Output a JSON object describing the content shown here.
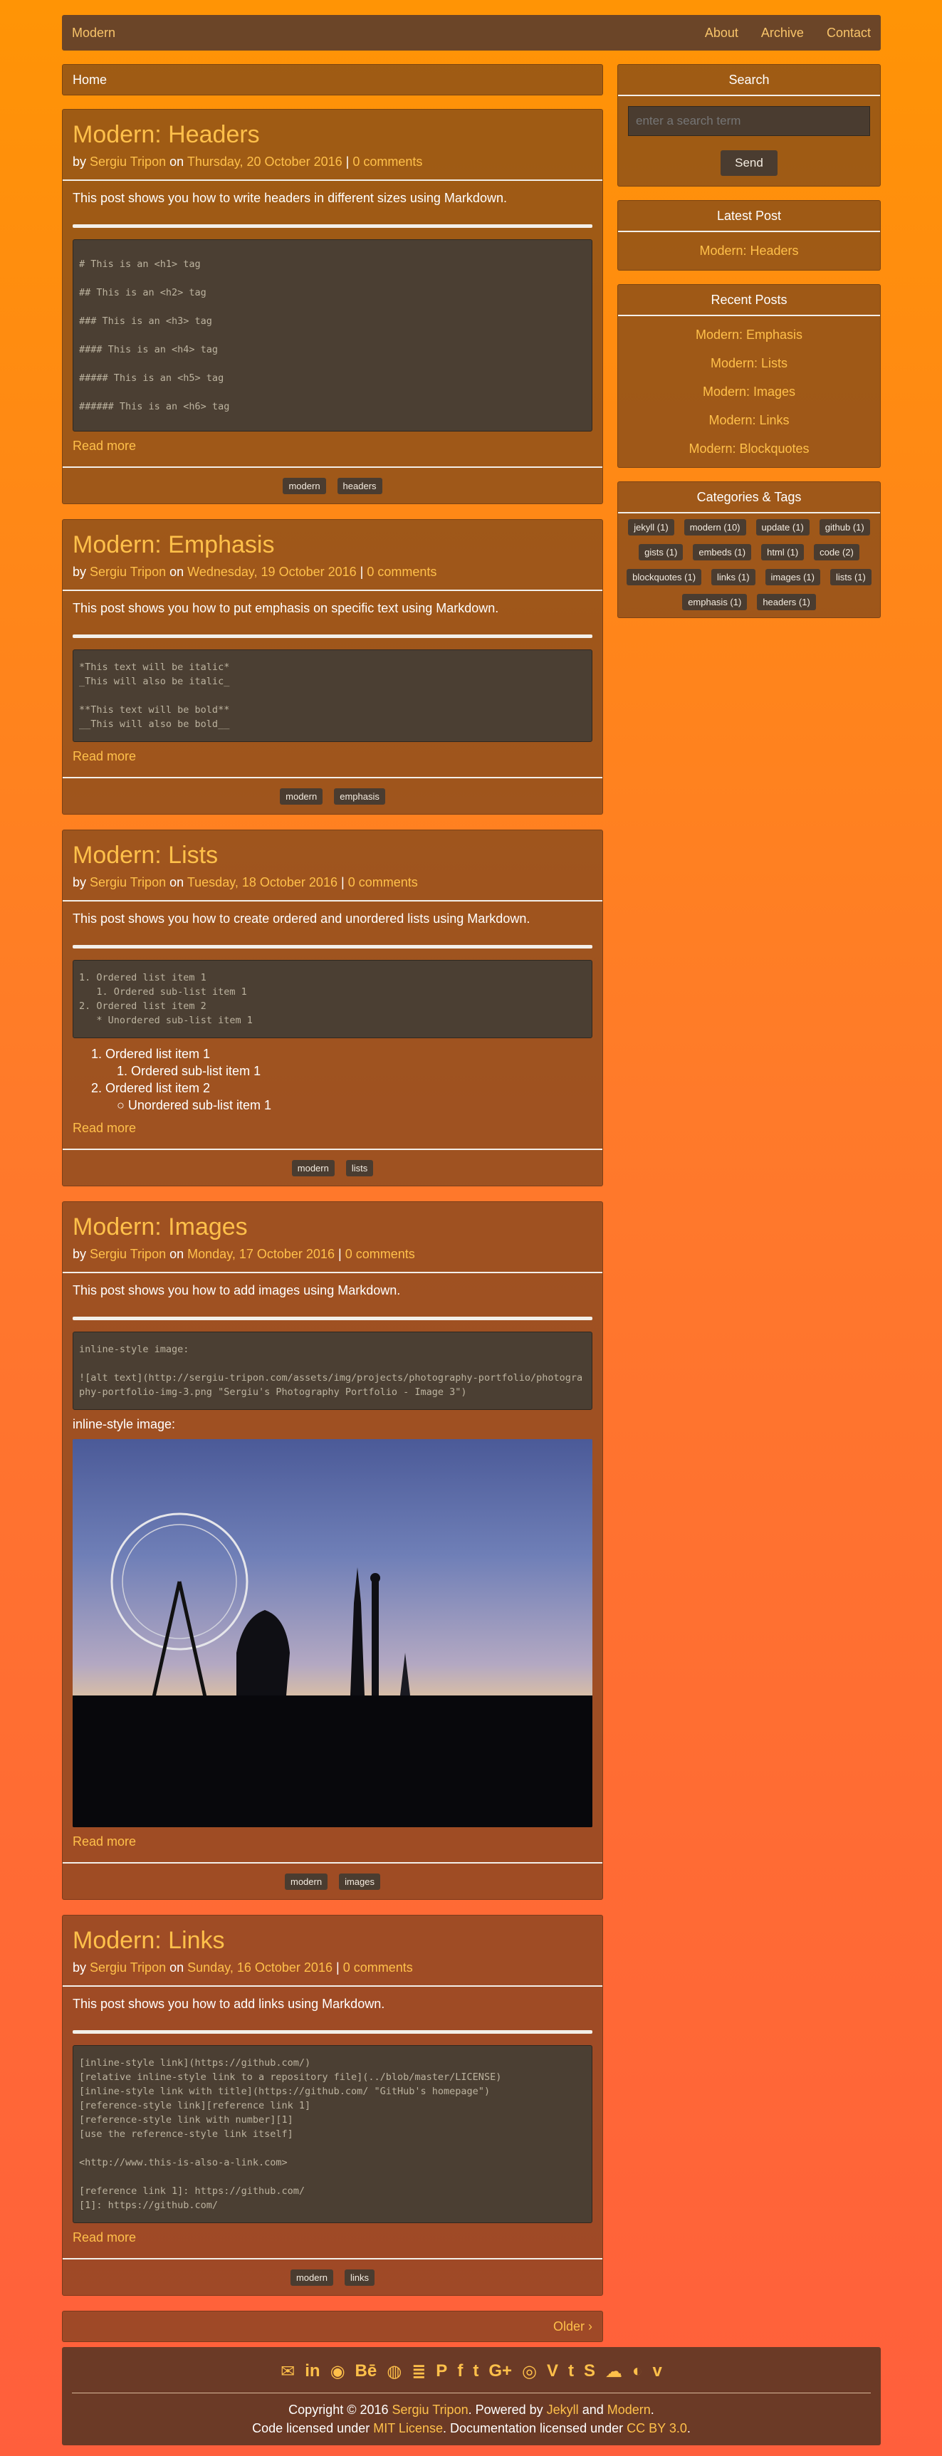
{
  "nav": {
    "brand": "Modern",
    "links": [
      "About",
      "Archive",
      "Contact"
    ]
  },
  "breadcrumb": "Home",
  "posts": [
    {
      "title": "Modern: Headers",
      "by": "by",
      "author": "Sergiu Tripon",
      "on": "on",
      "date": "Thursday, 20 October 2016",
      "sep": "|",
      "comments": "0 comments",
      "excerpt": "This post shows you how to write headers in different sizes using Markdown.",
      "code": "# This is an <h1> tag\n## This is an <h2> tag\n### This is an <h3> tag\n#### This is an <h4> tag\n##### This is an <h5> tag\n###### This is an <h6> tag",
      "read_more": "Read more",
      "tags": [
        "modern",
        "headers"
      ]
    },
    {
      "title": "Modern: Emphasis",
      "by": "by",
      "author": "Sergiu Tripon",
      "on": "on",
      "date": "Wednesday, 19 October 2016",
      "sep": "|",
      "comments": "0 comments",
      "excerpt": "This post shows you how to put emphasis on specific text using Markdown.",
      "code": "*This text will be italic*\n_This will also be italic_\n\n**This text will be bold**\n__This will also be bold__",
      "read_more": "Read more",
      "tags": [
        "modern",
        "emphasis"
      ]
    },
    {
      "title": "Modern: Lists",
      "by": "by",
      "author": "Sergiu Tripon",
      "on": "on",
      "date": "Tuesday, 18 October 2016",
      "sep": "|",
      "comments": "0 comments",
      "excerpt": "This post shows you how to create ordered and unordered lists using Markdown.",
      "code": "1. Ordered list item 1\n   1. Ordered sub-list item 1\n2. Ordered list item 2\n   * Unordered sub-list item 1",
      "list": [
        "1. Ordered list item 1",
        "1. Ordered sub-list item 1",
        "2. Ordered list item 2",
        "○ Unordered sub-list item 1"
      ],
      "read_more": "Read more",
      "tags": [
        "modern",
        "lists"
      ]
    },
    {
      "title": "Modern: Images",
      "by": "by",
      "author": "Sergiu Tripon",
      "on": "on",
      "date": "Monday, 17 October 2016",
      "sep": "|",
      "comments": "0 comments",
      "excerpt": "This post shows you how to add images using Markdown.",
      "code": "inline-style image:\n\n![alt text](http://sergiu-tripon.com/assets/img/projects/photography-portfolio/photography-portfolio-img-3.png \"Sergiu's Photography Portfolio - Image 3\")",
      "image_caption": "inline-style image:",
      "read_more": "Read more",
      "tags": [
        "modern",
        "images"
      ]
    },
    {
      "title": "Modern: Links",
      "by": "by",
      "author": "Sergiu Tripon",
      "on": "on",
      "date": "Sunday, 16 October 2016",
      "sep": "|",
      "comments": "0 comments",
      "excerpt": "This post shows you how to add links using Markdown.",
      "code": "[inline-style link](https://github.com/)\n[relative inline-style link to a repository file](../blob/master/LICENSE)\n[inline-style link with title](https://github.com/ \"GitHub's homepage\")\n[reference-style link][reference link 1]\n[reference-style link with number][1]\n[use the reference-style link itself]\n\n<http://www.this-is-also-a-link.com>\n\n[reference link 1]: https://github.com/\n[1]: https://github.com/",
      "read_more": "Read more",
      "tags": [
        "modern",
        "links"
      ]
    }
  ],
  "pager": {
    "older": "Older ›"
  },
  "sidebar": {
    "search": {
      "title": "Search",
      "placeholder": "enter a search term",
      "button": "Send"
    },
    "latest": {
      "title": "Latest Post",
      "post": "Modern: Headers"
    },
    "recent": {
      "title": "Recent Posts",
      "items": [
        "Modern: Emphasis",
        "Modern: Lists",
        "Modern: Images",
        "Modern: Links",
        "Modern: Blockquotes"
      ]
    },
    "categories": {
      "title": "Categories & Tags",
      "tags": [
        "jekyll (1)",
        "modern (10)",
        "update (1)",
        "github (1)",
        "gists (1)",
        "embeds (1)",
        "html (1)",
        "code (2)",
        "blockquotes (1)",
        "links (1)",
        "images (1)",
        "lists (1)",
        "emphasis (1)",
        "headers (1)"
      ]
    }
  },
  "footer": {
    "icons": [
      "email-icon",
      "linkedin-icon",
      "github-icon",
      "behance-icon",
      "dribbble-icon",
      "stackoverflow-icon",
      "paypal-icon",
      "facebook-icon",
      "twitter-icon",
      "googleplus-icon",
      "instagram-icon",
      "vine-icon",
      "tumblr-icon",
      "skype-icon",
      "soundcloud-icon",
      "spotify-icon",
      "vimeo-icon"
    ],
    "icon_glyphs": [
      "✉",
      "in",
      "◉",
      "Bē",
      "◍",
      "≣",
      "P",
      "f",
      "t",
      "G+",
      "◎",
      "V",
      "t",
      "S",
      "☁",
      "◐",
      "v"
    ],
    "copyright": "Copyright © 2016",
    "author": "Sergiu Tripon",
    "powered": ". Powered by",
    "jekyll": "Jekyll",
    "and": "and",
    "modern": "Modern",
    "period": ".",
    "code_licensed": "Code licensed under",
    "mit": "MIT License",
    "docs_licensed": ". Documentation licensed under",
    "cc": "CC BY 3.0",
    "end": "."
  }
}
